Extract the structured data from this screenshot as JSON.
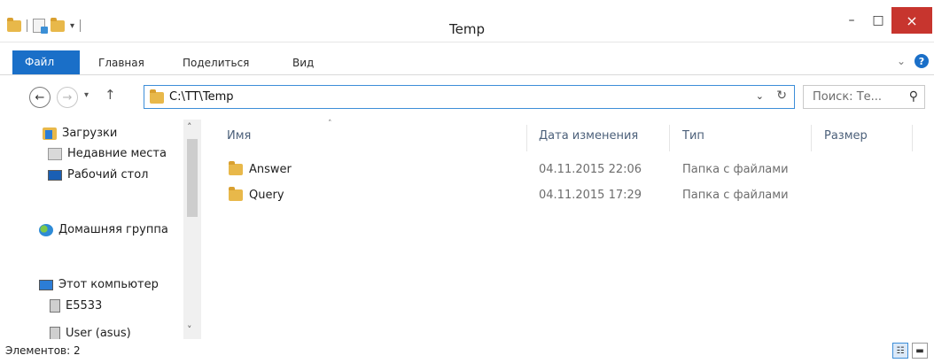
{
  "window": {
    "title": "Temp",
    "qat_dropdown": "▾",
    "minimize": "–",
    "maximize": "□",
    "close": "×"
  },
  "ribbon": {
    "tabs": [
      {
        "label": "Файл",
        "active": true
      },
      {
        "label": "Главная"
      },
      {
        "label": "Поделиться"
      },
      {
        "label": "Вид"
      }
    ],
    "expand": "⌄",
    "help": "?"
  },
  "nav": {
    "back": "←",
    "forward": "→",
    "recent": "▾",
    "up": "↑",
    "address": "C:\\TT\\Temp",
    "address_dropdown": "⌄",
    "refresh": "↻",
    "search_placeholder": "Поиск: Те...",
    "search_icon": "⚲"
  },
  "sidebar": {
    "items": [
      {
        "label": "Загрузки",
        "icon": "downloads-icon"
      },
      {
        "label": "Недавние места",
        "icon": "recent-places-icon"
      },
      {
        "label": "Рабочий стол",
        "icon": "desktop-icon"
      },
      {
        "label": "Домашняя группа",
        "icon": "homegroup-icon"
      },
      {
        "label": "Этот компьютер",
        "icon": "computer-icon"
      },
      {
        "label": "E5533",
        "icon": "network-drive-icon"
      },
      {
        "label": "User (asus)",
        "icon": "network-drive-icon"
      }
    ],
    "scroll_up": "˄",
    "scroll_down": "˅"
  },
  "filelist": {
    "columns": [
      "Имя",
      "Дата изменения",
      "Тип",
      "Размер"
    ],
    "sort_indicator": "˄",
    "rows": [
      {
        "name": "Answer",
        "date": "04.11.2015 22:06",
        "type": "Папка с файлами"
      },
      {
        "name": "Query",
        "date": "04.11.2015 17:29",
        "type": "Папка с файлами"
      }
    ]
  },
  "status": {
    "count": "Элементов: 2",
    "details_view": "☷",
    "large_icons_view": "▬"
  },
  "colors": {
    "accent": "#1a6fc8",
    "close": "#c7352e",
    "folder": "#e8b84a"
  }
}
